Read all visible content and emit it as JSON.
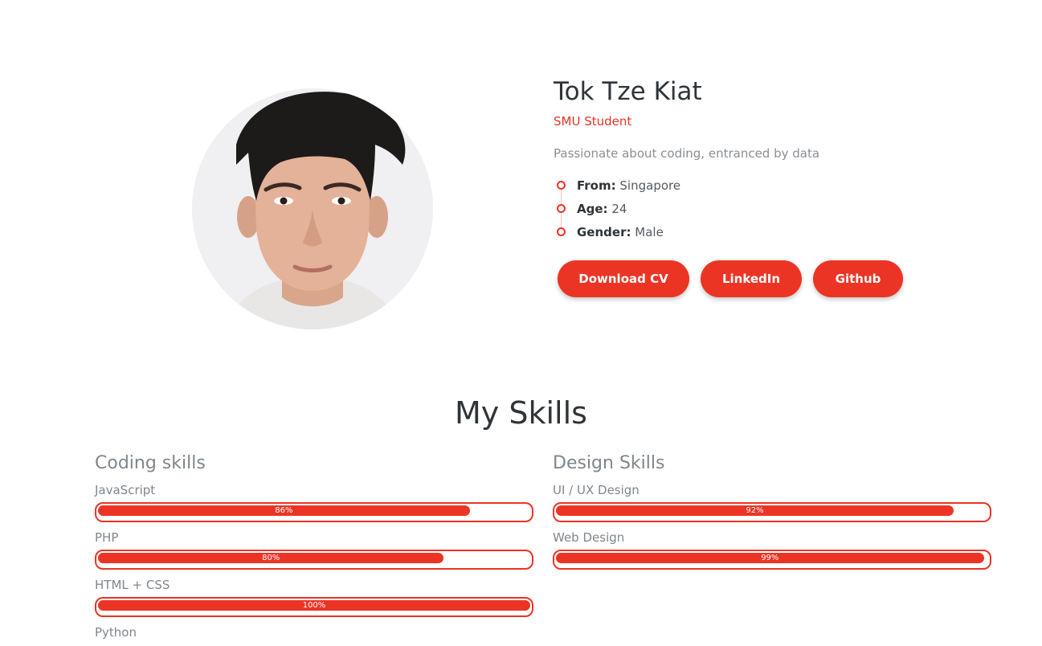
{
  "profile": {
    "name": "Tok Tze Kiat",
    "subtitle": "SMU Student",
    "tagline": "Passionate about coding, entranced by data",
    "facts": [
      {
        "key": "From:",
        "value": "Singapore"
      },
      {
        "key": "Age:",
        "value": "24"
      },
      {
        "key": "Gender:",
        "value": "Male"
      }
    ],
    "buttons": {
      "download_cv": "Download CV",
      "linkedin": "LinkedIn",
      "github": "Github"
    }
  },
  "skills": {
    "title": "My Skills",
    "coding": {
      "heading": "Coding skills",
      "items": [
        {
          "name": "JavaScript",
          "percent": 86,
          "label": "86%"
        },
        {
          "name": "PHP",
          "percent": 80,
          "label": "80%"
        },
        {
          "name": "HTML + CSS",
          "percent": 100,
          "label": "100%"
        },
        {
          "name": "Python"
        }
      ]
    },
    "design": {
      "heading": "Design Skills",
      "items": [
        {
          "name": "UI / UX Design",
          "percent": 92,
          "label": "92%"
        },
        {
          "name": "Web Design",
          "percent": 99,
          "label": "99%"
        }
      ]
    }
  },
  "colors": {
    "accent": "#ec3424",
    "heading": "#2f3438",
    "muted": "#7f868c"
  }
}
